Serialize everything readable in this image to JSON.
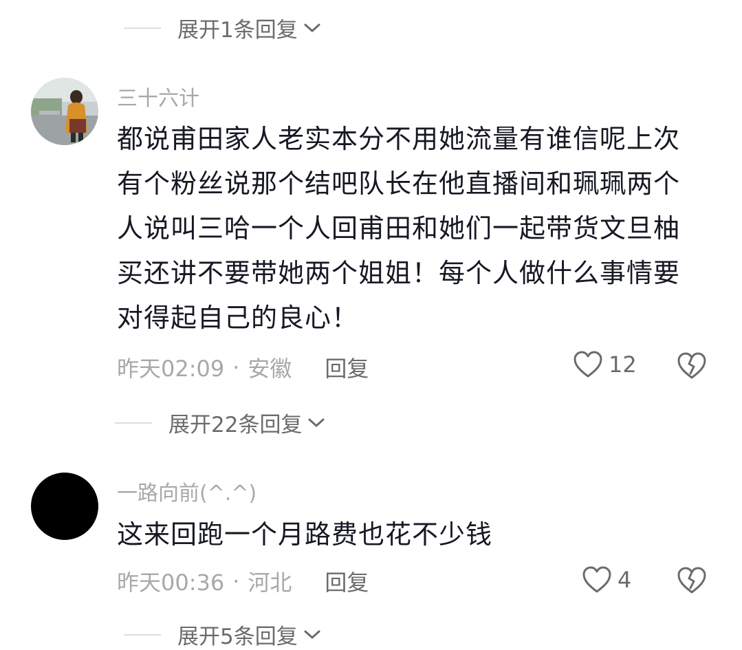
{
  "top_expand": {
    "label": "展开1条回复"
  },
  "comments": [
    {
      "username": "三十六计",
      "lines": [
        "都说甫田家人老实本分不用她流量有谁信呢上次",
        "有个粉丝说那个结吧队长在他直播间和珮珮两个",
        "人说叫三哈一个人回甫田和她们一起带货文旦柚",
        "买还讲不要带她两个姐姐！每个人做什么事情要",
        "对得起自己的良心！"
      ],
      "time": "昨天02:09",
      "location": "安徽",
      "reply_label": "回复",
      "likes": "12",
      "expand_label": "展开22条回复"
    },
    {
      "username": "一路向前(^.^)",
      "lines": [
        "这来回跑一个月路费也花不少钱"
      ],
      "time": "昨天00:36",
      "location": "河北",
      "reply_label": "回复",
      "likes": "4",
      "expand_label": "展开5条回复"
    }
  ],
  "separator": "·",
  "icons": {
    "like": "heart-outline-icon",
    "dislike": "broken-heart-icon",
    "expand": "chevron-down-icon"
  }
}
